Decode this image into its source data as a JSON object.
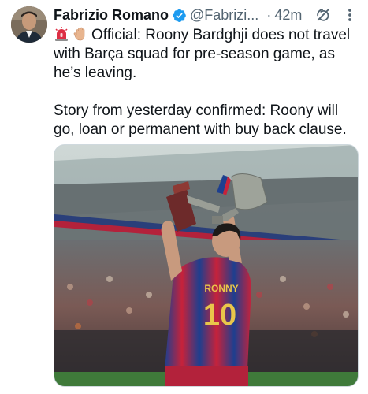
{
  "author": {
    "name": "Fabrizio Romano",
    "handle": "@Fabrizi...",
    "separator": "·",
    "time": "42m"
  },
  "tweet": {
    "line1_emojis": [
      "siren-emoji",
      "waving-hand-emoji"
    ],
    "paragraph1": "Official: Roony Bardghji does not travel with Barça squad for pre-season game, as he’s leaving.",
    "paragraph2": "Story from yesterday confirmed: Roony will go, loan or permanent with buy back clause."
  },
  "media": {
    "description_icon": "photo",
    "shirt_name": "RONNY",
    "shirt_number": "10"
  },
  "colors": {
    "verified": "#1d9bf0",
    "secondary_text": "#536471",
    "primary_text": "#0f1419"
  }
}
